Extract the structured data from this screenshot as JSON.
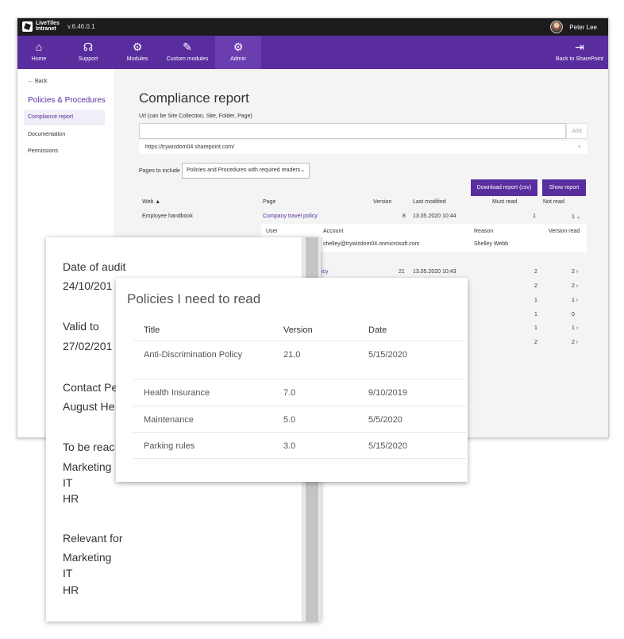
{
  "topbar": {
    "logo_text_1": "LiveTiles",
    "logo_text_2": "Intranet",
    "version": "v.6.46.0.1",
    "user_name": "Peter Lee"
  },
  "nav": {
    "items": [
      {
        "label": "Home",
        "icon": "⌂"
      },
      {
        "label": "Support",
        "icon": "☊"
      },
      {
        "label": "Modules",
        "icon": "⚙"
      },
      {
        "label": "Custom modules",
        "icon": "✎"
      },
      {
        "label": "Admin",
        "icon": "⚙"
      }
    ],
    "back_to_sharepoint": "Back to SharePoint",
    "back_icon": "⇥"
  },
  "sidebar": {
    "back": "Back",
    "title": "Policies & Procedures",
    "items": [
      "Compliance report",
      "Documentation",
      "Permissions"
    ]
  },
  "report": {
    "title": "Compliance report",
    "url_label": "Url (can be Site Collection, Site, Folder, Page)",
    "url_value": "",
    "add_label": "Add",
    "url_chip": "https://trywizdom04.sharepoint.com/",
    "url_chip_remove": "×",
    "pages_label": "Pages to include",
    "pages_select": "Policies and Procedures with required readers",
    "download_label": "Download report (csv)",
    "show_label": "Show report",
    "columns": {
      "web": "Web",
      "page": "Page",
      "version": "Version",
      "last_modified": "Last modified",
      "must_read": "Must read",
      "not_read": "Not read"
    },
    "row1": {
      "web": "Employee handbook",
      "page": "Company travel policy",
      "version": "8",
      "last_modified": "13.05.2020 10:44",
      "must_read": "1",
      "not_read": "1"
    },
    "detail": {
      "columns": {
        "user": "User",
        "account": "Account",
        "reason": "Reason",
        "version_read": "Version read"
      },
      "account": "shelley@trywizdom04.onmicrosoft.com",
      "reason": "Shelley Webb"
    },
    "row2": {
      "page_partial": "icy",
      "version": "21",
      "last_modified": "13.05.2020 10:43",
      "must_read": "2",
      "not_read": "2"
    },
    "more_rows": [
      {
        "must_read": "2",
        "not_read": "2"
      },
      {
        "must_read": "1",
        "not_read": "1"
      },
      {
        "must_read": "1",
        "not_read": "0"
      },
      {
        "must_read": "1",
        "not_read": "1"
      },
      {
        "must_read": "2",
        "not_read": "2"
      }
    ]
  },
  "doc": {
    "date_of_audit_label": "Date of audit",
    "date_of_audit_value": "24/10/201",
    "valid_to_label": "Valid to",
    "valid_to_value": "27/02/201",
    "contact_label": "Contact Pe",
    "contact_value": "August He",
    "to_be_read_label": "To be reac",
    "to_be_read_values": [
      "Marketing",
      "IT",
      "HR"
    ],
    "relevant_for_label": "Relevant for",
    "relevant_for_values": [
      "Marketing",
      "IT",
      "HR"
    ]
  },
  "policies": {
    "title": "Policies I need to read",
    "columns": {
      "title": "Title",
      "version": "Version",
      "date": "Date"
    },
    "rows": [
      {
        "title": "Anti-Discrimination Policy",
        "version": "21.0",
        "date": "5/15/2020"
      },
      {
        "title": "Health Insurance",
        "version": "7.0",
        "date": "9/10/2019"
      },
      {
        "title": "Maintenance",
        "version": "5.0",
        "date": "5/5/2020"
      },
      {
        "title": "Parking rules",
        "version": "3.0",
        "date": "5/15/2020"
      }
    ]
  },
  "colors": {
    "brand": "#5a2d9e",
    "topbar": "#1c1c1c"
  }
}
